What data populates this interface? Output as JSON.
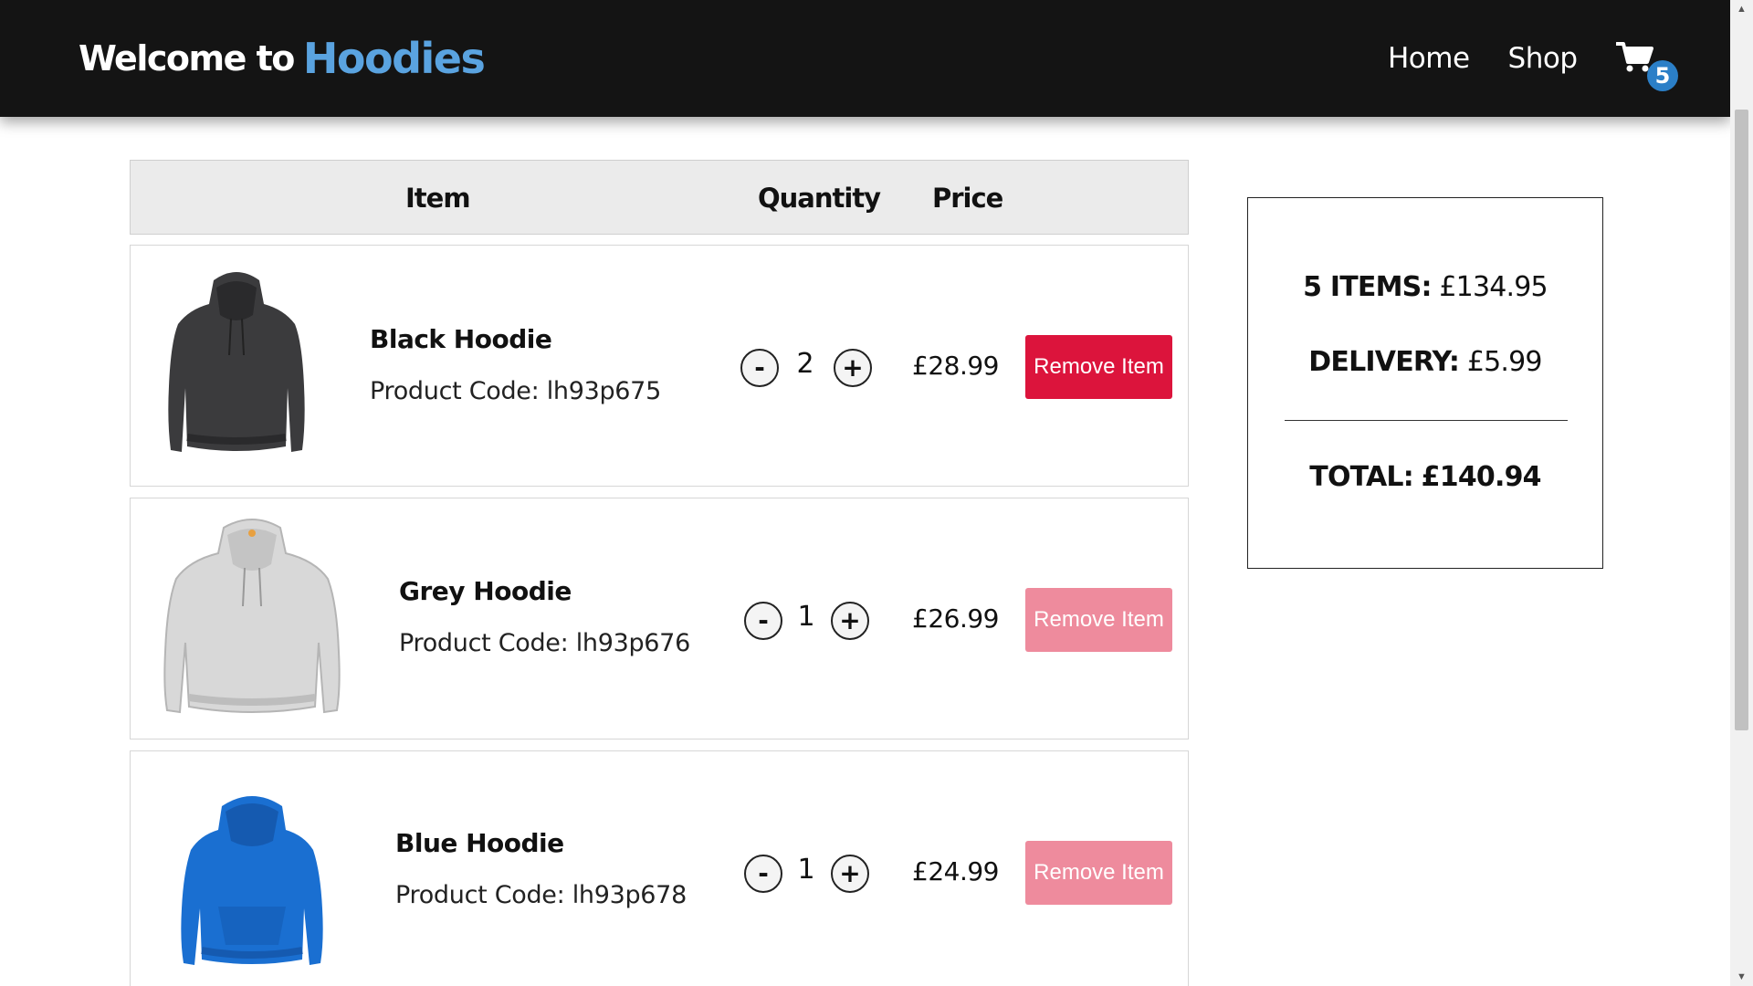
{
  "nav": {
    "welcome": "Welcome to",
    "brand": "Hoodies",
    "links": [
      "Home",
      "Shop"
    ],
    "cart_count": "5"
  },
  "table": {
    "headers": [
      "Item",
      "Quantity",
      "Price"
    ]
  },
  "items": [
    {
      "name": "Black Hoodie",
      "code": "Product Code: lh93p675",
      "quantity": "2",
      "price": "£28.99",
      "remove_label": "Remove Item",
      "color": "#3b3b3d",
      "remove_enabled": true
    },
    {
      "name": "Grey Hoodie",
      "code": "Product Code: lh93p676",
      "quantity": "1",
      "price": "£26.99",
      "remove_label": "Remove Item",
      "color": "#d6d6d6",
      "remove_enabled": false
    },
    {
      "name": "Blue Hoodie",
      "code": "Product Code: lh93p678",
      "quantity": "1",
      "price": "£24.99",
      "remove_label": "Remove Item",
      "color": "#1a6fd1",
      "remove_enabled": false
    }
  ],
  "qty_controls": {
    "decrement": "-",
    "increment": "+"
  },
  "summary": {
    "items_label": "5 ITEMS:",
    "items_value": "£134.95",
    "delivery_label": "DELIVERY:",
    "delivery_value": "£5.99",
    "total_label": "TOTAL:",
    "total_value": "£140.94"
  },
  "colors": {
    "navbar": "#141414",
    "brand_accent": "#5aa3e0",
    "badge": "#2b7fc7",
    "remove_active": "#dc143c",
    "remove_faded": "#ee8b9d"
  }
}
